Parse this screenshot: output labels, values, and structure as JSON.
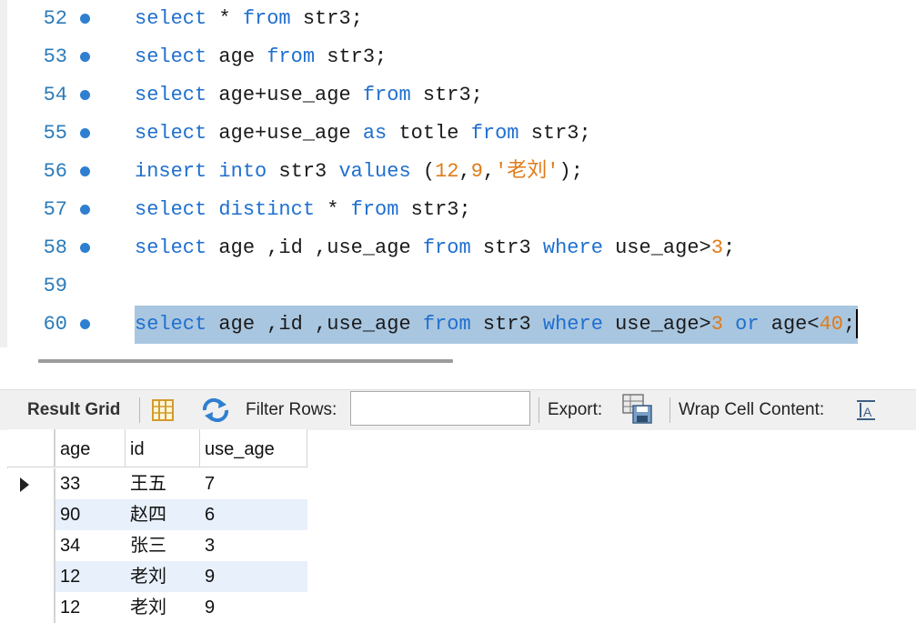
{
  "editor": {
    "lines": [
      {
        "num": "52",
        "bp": true,
        "tokens": [
          [
            "k",
            "select"
          ],
          [
            "t",
            " * "
          ],
          [
            "k",
            "from"
          ],
          [
            "t",
            " str3;"
          ]
        ]
      },
      {
        "num": "53",
        "bp": true,
        "tokens": [
          [
            "k",
            "select"
          ],
          [
            "t",
            " age "
          ],
          [
            "k",
            "from"
          ],
          [
            "t",
            " str3;"
          ]
        ]
      },
      {
        "num": "54",
        "bp": true,
        "tokens": [
          [
            "k",
            "select"
          ],
          [
            "t",
            " age+use_age "
          ],
          [
            "k",
            "from"
          ],
          [
            "t",
            " str3;"
          ]
        ]
      },
      {
        "num": "55",
        "bp": true,
        "tokens": [
          [
            "k",
            "select"
          ],
          [
            "t",
            " age+use_age "
          ],
          [
            "k",
            "as"
          ],
          [
            "t",
            " totle "
          ],
          [
            "k",
            "from"
          ],
          [
            "t",
            " str3;"
          ]
        ]
      },
      {
        "num": "56",
        "bp": true,
        "tokens": [
          [
            "k",
            "insert"
          ],
          [
            "t",
            " "
          ],
          [
            "k",
            "into"
          ],
          [
            "t",
            " str3 "
          ],
          [
            "k",
            "values"
          ],
          [
            "t",
            " ("
          ],
          [
            "n",
            "12"
          ],
          [
            "t",
            ","
          ],
          [
            "n",
            "9"
          ],
          [
            "t",
            ","
          ],
          [
            "s",
            "'老刘'"
          ],
          [
            "t",
            ");"
          ]
        ]
      },
      {
        "num": "57",
        "bp": true,
        "tokens": [
          [
            "k",
            "select"
          ],
          [
            "t",
            " "
          ],
          [
            "k",
            "distinct"
          ],
          [
            "t",
            " * "
          ],
          [
            "k",
            "from"
          ],
          [
            "t",
            " str3;"
          ]
        ]
      },
      {
        "num": "58",
        "bp": true,
        "tokens": [
          [
            "k",
            "select"
          ],
          [
            "t",
            " age ,id ,use_age "
          ],
          [
            "k",
            "from"
          ],
          [
            "t",
            " str3 "
          ],
          [
            "k",
            "where"
          ],
          [
            "t",
            " use_age>"
          ],
          [
            "n",
            "3"
          ],
          [
            "t",
            ";"
          ]
        ]
      },
      {
        "num": "59",
        "bp": false,
        "tokens": []
      },
      {
        "num": "60",
        "bp": true,
        "selected": true,
        "tokens": [
          [
            "k",
            "select"
          ],
          [
            "t",
            " age ,id ,use_age "
          ],
          [
            "k",
            "from"
          ],
          [
            "t",
            " str3 "
          ],
          [
            "k",
            "where"
          ],
          [
            "t",
            " use_age>"
          ],
          [
            "n",
            "3"
          ],
          [
            "t",
            " "
          ],
          [
            "k",
            "or"
          ],
          [
            "t",
            " age<"
          ],
          [
            "n",
            "40"
          ],
          [
            "t",
            ";"
          ]
        ]
      }
    ]
  },
  "toolbar": {
    "result_grid": "Result Grid",
    "filter_rows": "Filter Rows:",
    "filter_value": "",
    "export": "Export:",
    "wrap": "Wrap Cell Content:"
  },
  "grid": {
    "columns": [
      "age",
      "id",
      "use_age"
    ],
    "rows": [
      [
        "33",
        "王五",
        "7"
      ],
      [
        "90",
        "赵四",
        "6"
      ],
      [
        "34",
        "张三",
        "3"
      ],
      [
        "12",
        "老刘",
        "9"
      ],
      [
        "12",
        "老刘",
        "9"
      ]
    ]
  }
}
